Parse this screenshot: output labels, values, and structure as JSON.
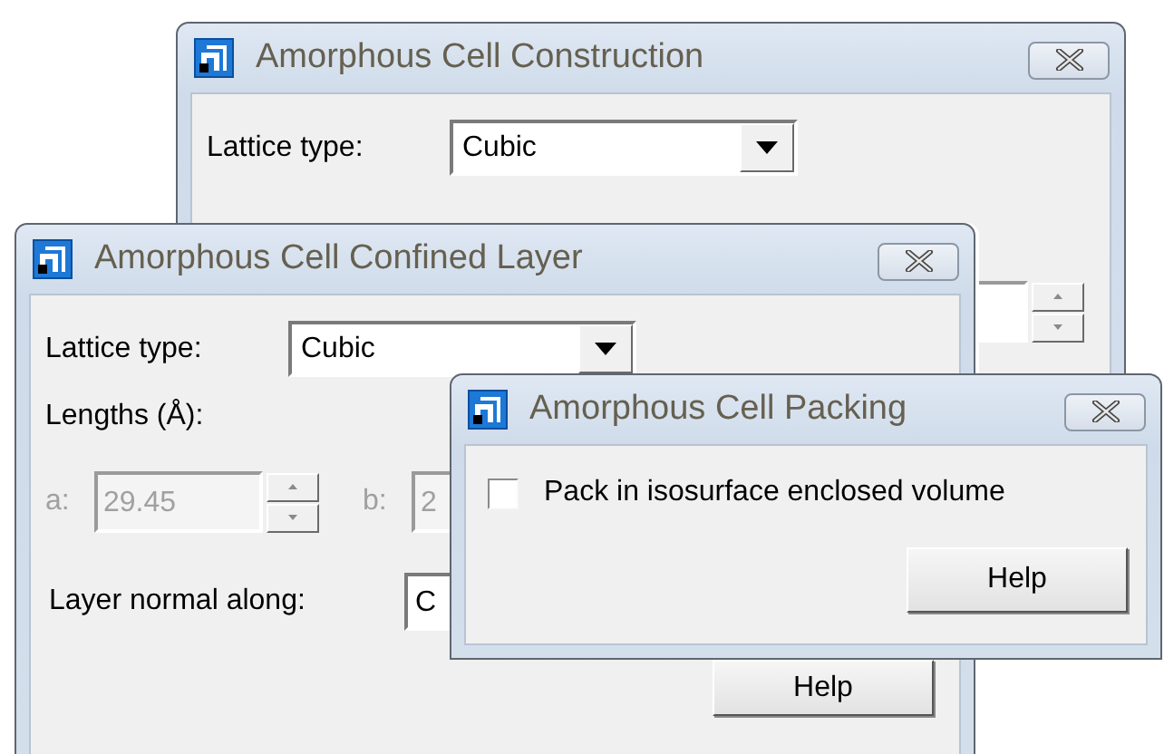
{
  "windows": [
    {
      "title": "Amorphous Cell Construction",
      "rows": [
        {
          "kind": "dropdown",
          "label": "Lattice type:",
          "value": "Cubic"
        },
        {
          "kind": "lengths-tail"
        }
      ]
    },
    {
      "title": "Amorphous Cell Confined Layer",
      "rows": [
        {
          "kind": "dropdown",
          "label": "Lattice type:",
          "value": "Cubic"
        },
        {
          "kind": "heading",
          "label": "Lengths (Å):"
        },
        {
          "kind": "lengths",
          "fields": [
            {
              "label": "a:",
              "value": "29.45",
              "disabled": true,
              "spinner": true
            },
            {
              "label": "b:",
              "value": "2",
              "disabled": true,
              "spinner": false
            }
          ]
        },
        {
          "kind": "field",
          "label": "Layer normal along:",
          "value": "C"
        },
        {
          "kind": "buttons",
          "buttons": [
            "Help"
          ]
        }
      ]
    },
    {
      "title": "Amorphous Cell Packing",
      "rows": [
        {
          "kind": "checkbox",
          "label": "Pack in isosurface enclosed volume",
          "checked": false
        },
        {
          "kind": "buttons",
          "buttons": [
            "Help"
          ]
        }
      ]
    }
  ]
}
